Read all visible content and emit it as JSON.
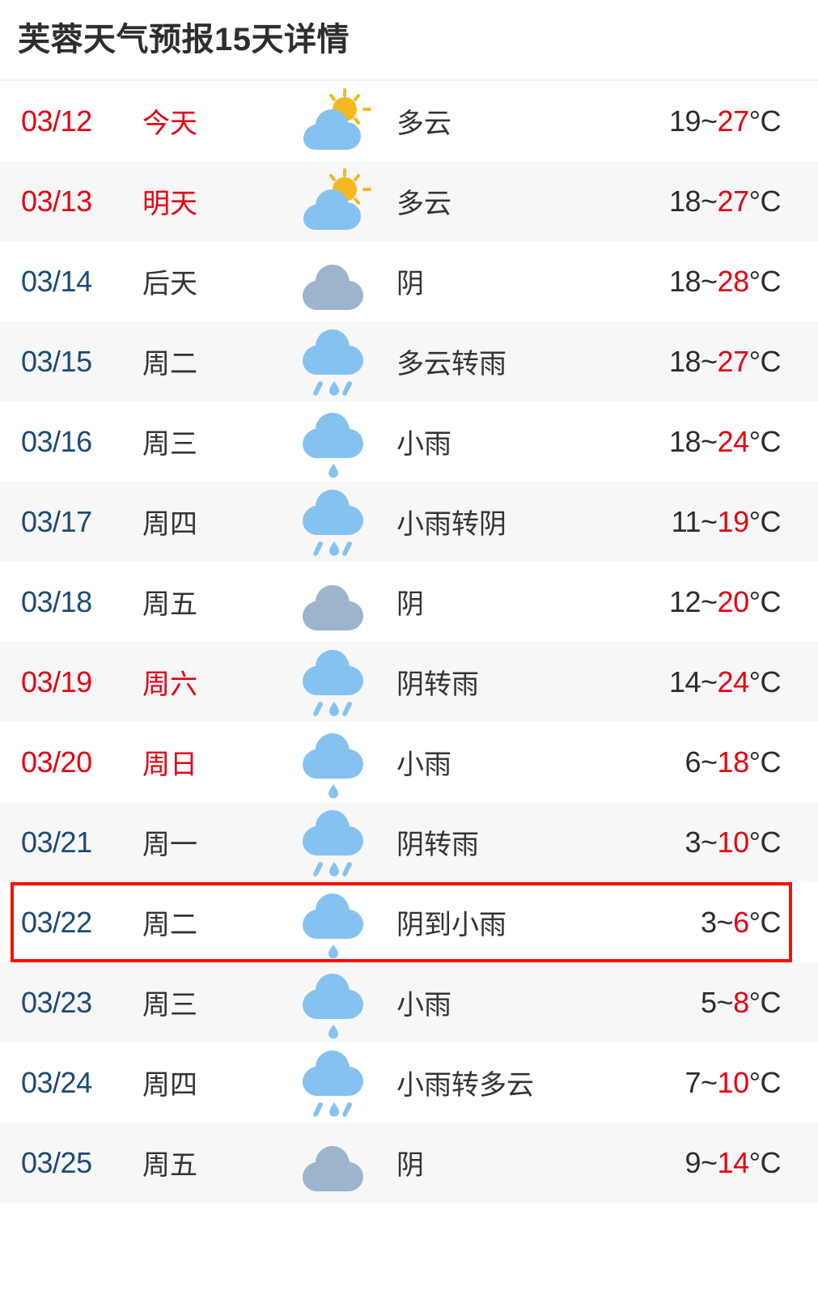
{
  "header": {
    "title": "芙蓉天气预报15天详情"
  },
  "colors": {
    "accent_red": "#e60012",
    "highlight_border": "#fa0f00",
    "date_blue": "#1b4a77",
    "text_dark": "#333333",
    "row_alt_bg": "#f7f7f8",
    "cloud_blue": "#86c2f0",
    "cloud_gray": "#9db4cd",
    "sun_yellow": "#f5b822"
  },
  "forecast": {
    "rows": [
      {
        "date": "03/12",
        "weekday": "今天",
        "icon": "partly-cloudy-icon",
        "desc": "多云",
        "low": "19",
        "sep": "~",
        "high": "27",
        "unit": "°C",
        "red_date": true,
        "highlighted": false
      },
      {
        "date": "03/13",
        "weekday": "明天",
        "icon": "partly-cloudy-icon",
        "desc": "多云",
        "low": "18",
        "sep": "~",
        "high": "27",
        "unit": "°C",
        "red_date": true,
        "highlighted": false
      },
      {
        "date": "03/14",
        "weekday": "后天",
        "icon": "overcast-icon",
        "desc": "阴",
        "low": "18",
        "sep": "~",
        "high": "28",
        "unit": "°C",
        "red_date": false,
        "highlighted": false
      },
      {
        "date": "03/15",
        "weekday": "周二",
        "icon": "rain-heavy-icon",
        "desc": "多云转雨",
        "low": "18",
        "sep": "~",
        "high": "27",
        "unit": "°C",
        "red_date": false,
        "highlighted": false
      },
      {
        "date": "03/16",
        "weekday": "周三",
        "icon": "rain-light-icon",
        "desc": "小雨",
        "low": "18",
        "sep": "~",
        "high": "24",
        "unit": "°C",
        "red_date": false,
        "highlighted": false
      },
      {
        "date": "03/17",
        "weekday": "周四",
        "icon": "rain-heavy-icon",
        "desc": "小雨转阴",
        "low": "11",
        "sep": "~",
        "high": "19",
        "unit": "°C",
        "red_date": false,
        "highlighted": false
      },
      {
        "date": "03/18",
        "weekday": "周五",
        "icon": "overcast-icon",
        "desc": "阴",
        "low": "12",
        "sep": "~",
        "high": "20",
        "unit": "°C",
        "red_date": false,
        "highlighted": false
      },
      {
        "date": "03/19",
        "weekday": "周六",
        "icon": "rain-heavy-icon",
        "desc": "阴转雨",
        "low": "14",
        "sep": "~",
        "high": "24",
        "unit": "°C",
        "red_date": true,
        "highlighted": false
      },
      {
        "date": "03/20",
        "weekday": "周日",
        "icon": "rain-light-icon",
        "desc": "小雨",
        "low": "6",
        "sep": "~",
        "high": "18",
        "unit": "°C",
        "red_date": true,
        "highlighted": false
      },
      {
        "date": "03/21",
        "weekday": "周一",
        "icon": "rain-heavy-icon",
        "desc": "阴转雨",
        "low": "3",
        "sep": "~",
        "high": "10",
        "unit": "°C",
        "red_date": false,
        "highlighted": false
      },
      {
        "date": "03/22",
        "weekday": "周二",
        "icon": "rain-light-icon",
        "desc": "阴到小雨",
        "low": "3",
        "sep": "~",
        "high": "6",
        "unit": "°C",
        "red_date": false,
        "highlighted": true
      },
      {
        "date": "03/23",
        "weekday": "周三",
        "icon": "rain-light-icon",
        "desc": "小雨",
        "low": "5",
        "sep": "~",
        "high": "8",
        "unit": "°C",
        "red_date": false,
        "highlighted": false
      },
      {
        "date": "03/24",
        "weekday": "周四",
        "icon": "rain-heavy-icon",
        "desc": "小雨转多云",
        "low": "7",
        "sep": "~",
        "high": "10",
        "unit": "°C",
        "red_date": false,
        "highlighted": false
      },
      {
        "date": "03/25",
        "weekday": "周五",
        "icon": "overcast-icon",
        "desc": "阴",
        "low": "9",
        "sep": "~",
        "high": "14",
        "unit": "°C",
        "red_date": false,
        "highlighted": false
      }
    ]
  }
}
